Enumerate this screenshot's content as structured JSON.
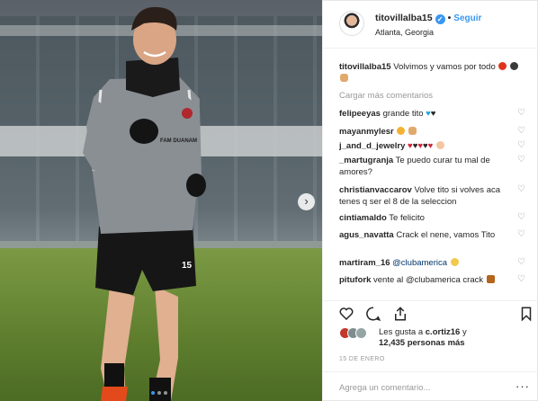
{
  "header": {
    "username": "titovillalba15",
    "follow_label": "Seguir",
    "location": "Atlanta, Georgia"
  },
  "photo": {
    "jersey_text": "FAM DUANAM",
    "shorts_number": "15",
    "carousel_next": "›"
  },
  "caption": {
    "username": "titovillalba15",
    "text": "Volvimos y vamos por todo"
  },
  "load_more_label": "Cargar más comentarios",
  "comments": [
    {
      "username": "felipeeyas",
      "text": "grande tito"
    },
    {
      "username": "mayanmylesr",
      "text": ""
    },
    {
      "username": "j_and_d_jewelry",
      "text": ""
    },
    {
      "username": "_martugranja",
      "text": "Te puedo curar tu mal de amores?"
    },
    {
      "username": "christianvaccarov",
      "text": "Volve tito si volves aca tenes q ser el 8 de la seleccion"
    },
    {
      "username": "cintiamaldo",
      "text": "Te felicito"
    },
    {
      "username": "agus_navatta",
      "text": "Crack el nene, vamos Tito"
    },
    {
      "username": "martiram_16",
      "text": "@clubamerica"
    },
    {
      "username": "pitufork",
      "text": "vente al @clubamerica crack"
    }
  ],
  "likes": {
    "prefix": "Les gusta a ",
    "user": "c.ortiz16",
    "mid": " y",
    "count": "12,435 personas más"
  },
  "date": "15 DE ENERO",
  "add_comment_placeholder": "Agrega un comentario...",
  "more_label": "···",
  "colors": {
    "link_blue": "#3897f0",
    "muted": "#999999",
    "text": "#262626",
    "verified": "#3897f0"
  },
  "icons": [
    "heart-icon",
    "comment-icon",
    "share-icon",
    "bookmark-icon",
    "verified-icon",
    "chevron-right-icon"
  ]
}
